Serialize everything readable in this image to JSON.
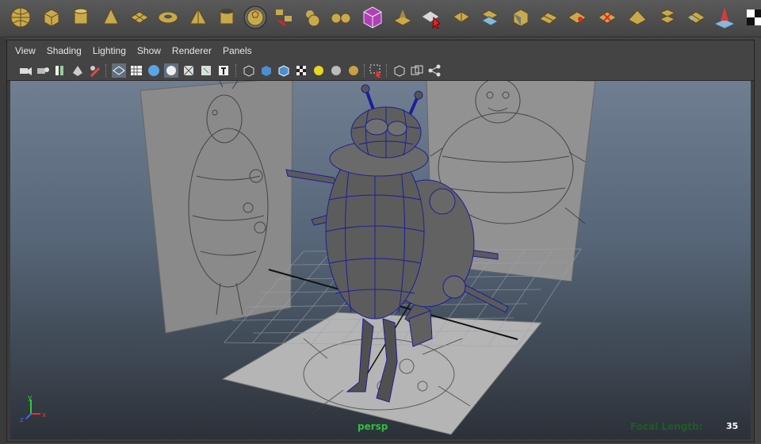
{
  "menu": {
    "view": "View",
    "shading": "Shading",
    "lighting": "Lighting",
    "show": "Show",
    "renderer": "Renderer",
    "panels": "Panels"
  },
  "shelf_icons": [
    "sphere-icon",
    "cube-icon",
    "cylinder-icon",
    "cone-icon",
    "plane-icon",
    "torus-icon",
    "pyramid-icon",
    "pipe-icon",
    "soccerball-icon",
    "poly-split-icon",
    "combine-icon",
    "separate-icon",
    "material-cube-icon",
    "extrude-icon",
    "append-icon",
    "bevel-icon",
    "bridge-icon",
    "extract-icon",
    "smooth-icon",
    "wedge-icon",
    "merge-icon",
    "poke-icon",
    "split-face-icon",
    "duplicate-icon",
    "sculpt-icon",
    "triangulate-icon",
    "checker-icon"
  ],
  "viewport": {
    "camera": "persp",
    "focal_label": "Focal Length:",
    "focal_value": "35",
    "axis_x": "x",
    "axis_y": "y",
    "axis_z": "z"
  },
  "colors": {
    "camera_label": "#2fbf3e",
    "wireframe": "#1e1e96",
    "background_top": "#6f7f91",
    "background_bottom": "#2c3138"
  }
}
